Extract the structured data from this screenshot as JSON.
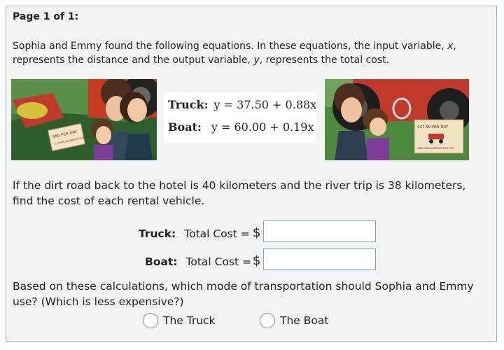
{
  "page_label": "Page 1 of 1:",
  "intro": {
    "part1": "Sophia and Emmy found the following equations.  In these equations, the input variable, ",
    "var_x": "x",
    "part2": ", represents the distance and the output variable, ",
    "var_y": "y",
    "part3": ", represents the total cost."
  },
  "equations": {
    "truck_label": "Truck:",
    "truck_eq": "y = 37.50 + 0.88x",
    "boat_label": "Boat:",
    "boat_eq": "y = 60.00 + 0.19x"
  },
  "images": {
    "left_sign_text": "$60 PER DAY",
    "left_sign_sub": "$.19 PER KILOMETER FUEL FEE",
    "right_sign_text": "$37.50 PER DAY",
    "right_sign_sub": "$.88 PER KILOMETER FUEL FEE"
  },
  "question": "If the dirt road back to the hotel is 40 kilometers and the river trip is 38 kilometers, find the cost of each rental vehicle.",
  "answers": {
    "truck_label": "Truck:",
    "truck_total": "Total Cost =",
    "boat_label": "Boat:",
    "boat_total": "Total Cost =",
    "currency": "$",
    "truck_value": "",
    "boat_value": ""
  },
  "question2": "Based on these calculations, which mode of transportation should Sophia and Emmy use? (Which is less expensive?)",
  "options": [
    "The Truck",
    "The Boat"
  ],
  "colors": {
    "border": "#8ab4c4",
    "input_border": "#6fa7b8",
    "background": "#f3f3f3"
  }
}
